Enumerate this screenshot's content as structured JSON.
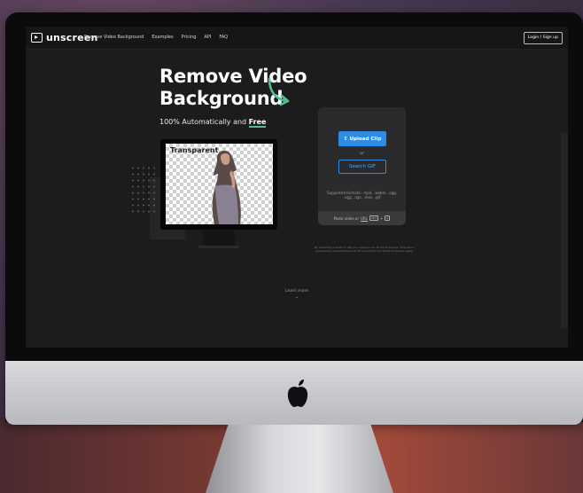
{
  "nav": {
    "logo_text": "unscreen",
    "links": [
      "Remove Video Background",
      "Examples",
      "Pricing",
      "API",
      "FAQ"
    ],
    "login_label": "Login / Sign up"
  },
  "hero": {
    "title_line1": "Remove Video",
    "title_line2": "Background",
    "subtitle_prefix": "100% Automatically and",
    "subtitle_emphasis": "Free",
    "accent_color": "#4fc08d"
  },
  "demo": {
    "label": "Transparent"
  },
  "upload_card": {
    "upload_label": "Upload Clip",
    "upload_icon": "upload-icon",
    "or_label": "or",
    "search_label": "Search GIF",
    "formats_text": "Supported formats: .mp4, .webm, .ogg, .ogg, .ogv, .mov, .gif",
    "paste_prefix": "Paste video or",
    "paste_url": "URL",
    "paste_key1": "ctrl",
    "paste_plus": "+",
    "paste_key2": "v",
    "button_color": "#2f8ce4"
  },
  "terms_text": "By uploading a video or URL you agree to our Terms of Service. This site is protected by reCaptcha and its Privacy Policy and Terms of Service apply.",
  "learn_more": {
    "label": "Learn more",
    "chevron": "⌄"
  }
}
